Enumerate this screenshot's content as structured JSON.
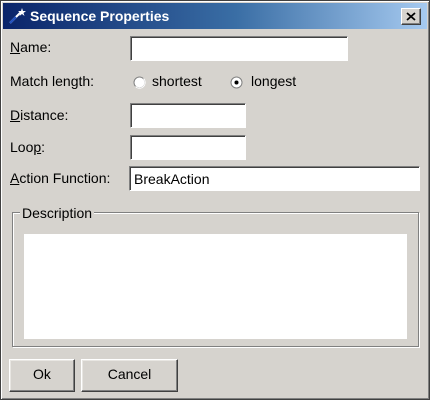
{
  "window": {
    "title": "Sequence Properties",
    "close_glyph": "X"
  },
  "form": {
    "name": {
      "label_first": "N",
      "label_rest": "ame:",
      "value": ""
    },
    "match_length": {
      "label": "Match length:",
      "options": [
        {
          "label_first": "s",
          "label_rest": "hortest",
          "selected": false
        },
        {
          "label_first": "l",
          "label_rest": "ongest",
          "selected": true
        }
      ]
    },
    "distance": {
      "label_first": "D",
      "label_rest": "istance:",
      "value": ""
    },
    "loop": {
      "label_first": "Loo",
      "label_mid": "p",
      "label_rest": ":",
      "value": ""
    },
    "action_function": {
      "label_first": "A",
      "label_rest": "ction Function:",
      "value": "BreakAction"
    }
  },
  "description": {
    "legend": "Description",
    "value": ""
  },
  "buttons": {
    "ok": "Ok",
    "cancel": "Cancel"
  },
  "colors": {
    "titlebar_start": "#0a246a",
    "titlebar_end": "#a6caf0",
    "dialog_face": "#d6d3ce"
  }
}
